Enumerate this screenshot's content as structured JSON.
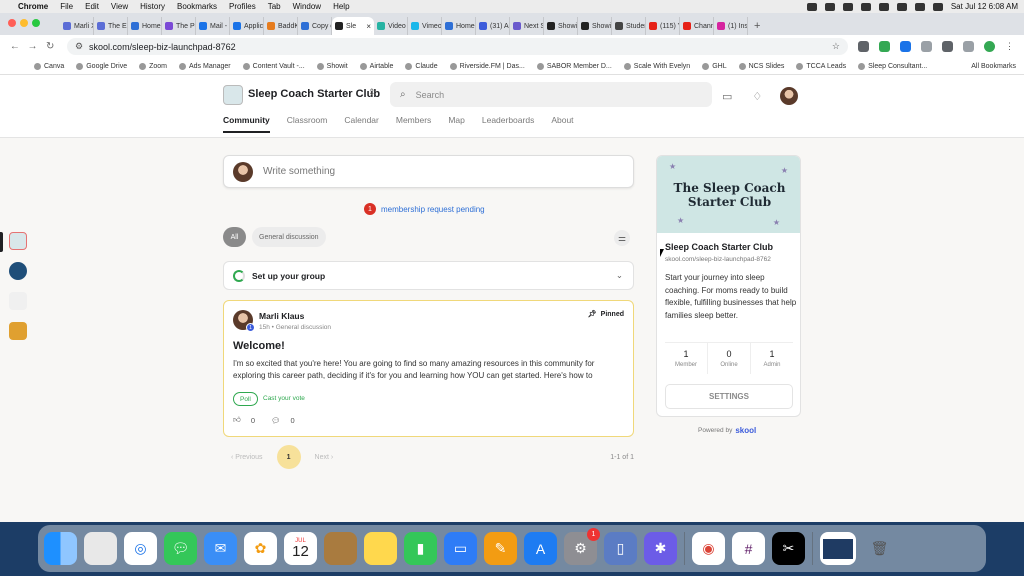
{
  "menubar": {
    "items": [
      "Chrome",
      "File",
      "Edit",
      "View",
      "History",
      "Bookmarks",
      "Profiles",
      "Tab",
      "Window",
      "Help"
    ],
    "datetime": "Sat Jul 12  6:08 AM"
  },
  "tabs": [
    {
      "label": "Marli X",
      "color": "#5b6dd6"
    },
    {
      "label": "The En",
      "color": "#5b6dd6"
    },
    {
      "label": "Home",
      "color": "#2e6fd6"
    },
    {
      "label": "The Po",
      "color": "#7b4ad6"
    },
    {
      "label": "Mail - \\",
      "color": "#1a73e8"
    },
    {
      "label": "Applic",
      "color": "#1a73e8"
    },
    {
      "label": "BaddK",
      "color": "#e67c1e"
    },
    {
      "label": "Copy o",
      "color": "#2e6fd6"
    },
    {
      "label": "Sle",
      "color": "#ffffff",
      "active": true
    },
    {
      "label": "Video",
      "color": "#26b3a3"
    },
    {
      "label": "Vimeo",
      "color": "#1ab7ea"
    },
    {
      "label": "Home",
      "color": "#2e6fd6"
    },
    {
      "label": "(31) Ac",
      "color": "#3b5bdb"
    },
    {
      "label": "Next S",
      "color": "#6a5acd"
    },
    {
      "label": "Showit",
      "color": "#222222"
    },
    {
      "label": "Showit",
      "color": "#222222"
    },
    {
      "label": "Studen",
      "color": "#444444"
    },
    {
      "label": "(115) Y",
      "color": "#e62117"
    },
    {
      "label": "Chann",
      "color": "#e62117"
    },
    {
      "label": "(1) Inst",
      "color": "#d6249f"
    }
  ],
  "address": {
    "url": "skool.com/sleep-biz-launchpad-8762"
  },
  "bookmarks": [
    "Canva",
    "Google Drive",
    "Zoom",
    "Ads Manager",
    "Content Vault -...",
    "Showit",
    "Airtable",
    "Claude",
    "Riverside.FM | Das...",
    "SABOR Member D...",
    "Scale With Evelyn",
    "GHL",
    "NCS Slides",
    "TCCA Leads",
    "Sleep Consultant..."
  ],
  "bookmarks_all": "All Bookmarks",
  "header": {
    "group_name": "Sleep Coach Starter Club",
    "search_placeholder": "Search",
    "nav": [
      "Community",
      "Classroom",
      "Calendar",
      "Members",
      "Map",
      "Leaderboards",
      "About"
    ]
  },
  "composer": {
    "placeholder": "Write something"
  },
  "pending": {
    "count": "1",
    "text": "membership request pending"
  },
  "filters": [
    "All",
    "General discussion"
  ],
  "setup": {
    "label": "Set up your group"
  },
  "post": {
    "author": "Marli Klaus",
    "level": "1",
    "meta": "15h • General discussion",
    "pinned": "Pinned",
    "title": "Welcome!",
    "body": "I'm so excited that you're here! You are going to find so many amazing resources in this community for exploring this career path, deciding if it's for you and learning how YOU can get started. Here's how to",
    "poll": "Poll",
    "vote": "Cast your vote",
    "likes": "0",
    "comments": "0"
  },
  "pager": {
    "prev": "Previous",
    "page": "1",
    "next": "Next",
    "range": "1-1 of 1"
  },
  "aside": {
    "cover_line1": "The Sleep Coach",
    "cover_line2": "Starter Club",
    "name": "Sleep Coach Starter Club",
    "url": "skool.com/sleep-biz-launchpad-8762",
    "description": "Start your journey into sleep coaching. For moms ready to build flexible, fulfilling businesses that help families sleep better.",
    "stats": [
      {
        "value": "1",
        "label": "Member"
      },
      {
        "value": "0",
        "label": "Online"
      },
      {
        "value": "1",
        "label": "Admin"
      }
    ],
    "settings": "SETTINGS"
  },
  "powered": {
    "prefix": "Powered by",
    "brand": "skool"
  },
  "dock": {
    "calendar_month": "JUL",
    "calendar_day": "12",
    "settings_badge": "1"
  }
}
